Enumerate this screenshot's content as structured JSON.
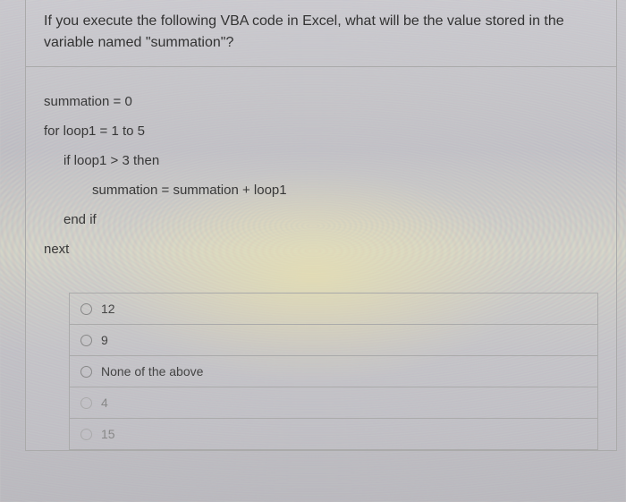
{
  "question": {
    "prompt": "If you execute the following VBA code in Excel, what will be the value stored in the variable named \"summation\"?"
  },
  "code": {
    "line1": "summation = 0",
    "line2": "for loop1 = 1 to 5",
    "line3": "if loop1 > 3 then",
    "line4": "summation = summation + loop1",
    "line5": "end if",
    "line6": "next"
  },
  "options": [
    {
      "label": "12"
    },
    {
      "label": "9"
    },
    {
      "label": "None of the above"
    },
    {
      "label": "4"
    },
    {
      "label": "15"
    }
  ]
}
